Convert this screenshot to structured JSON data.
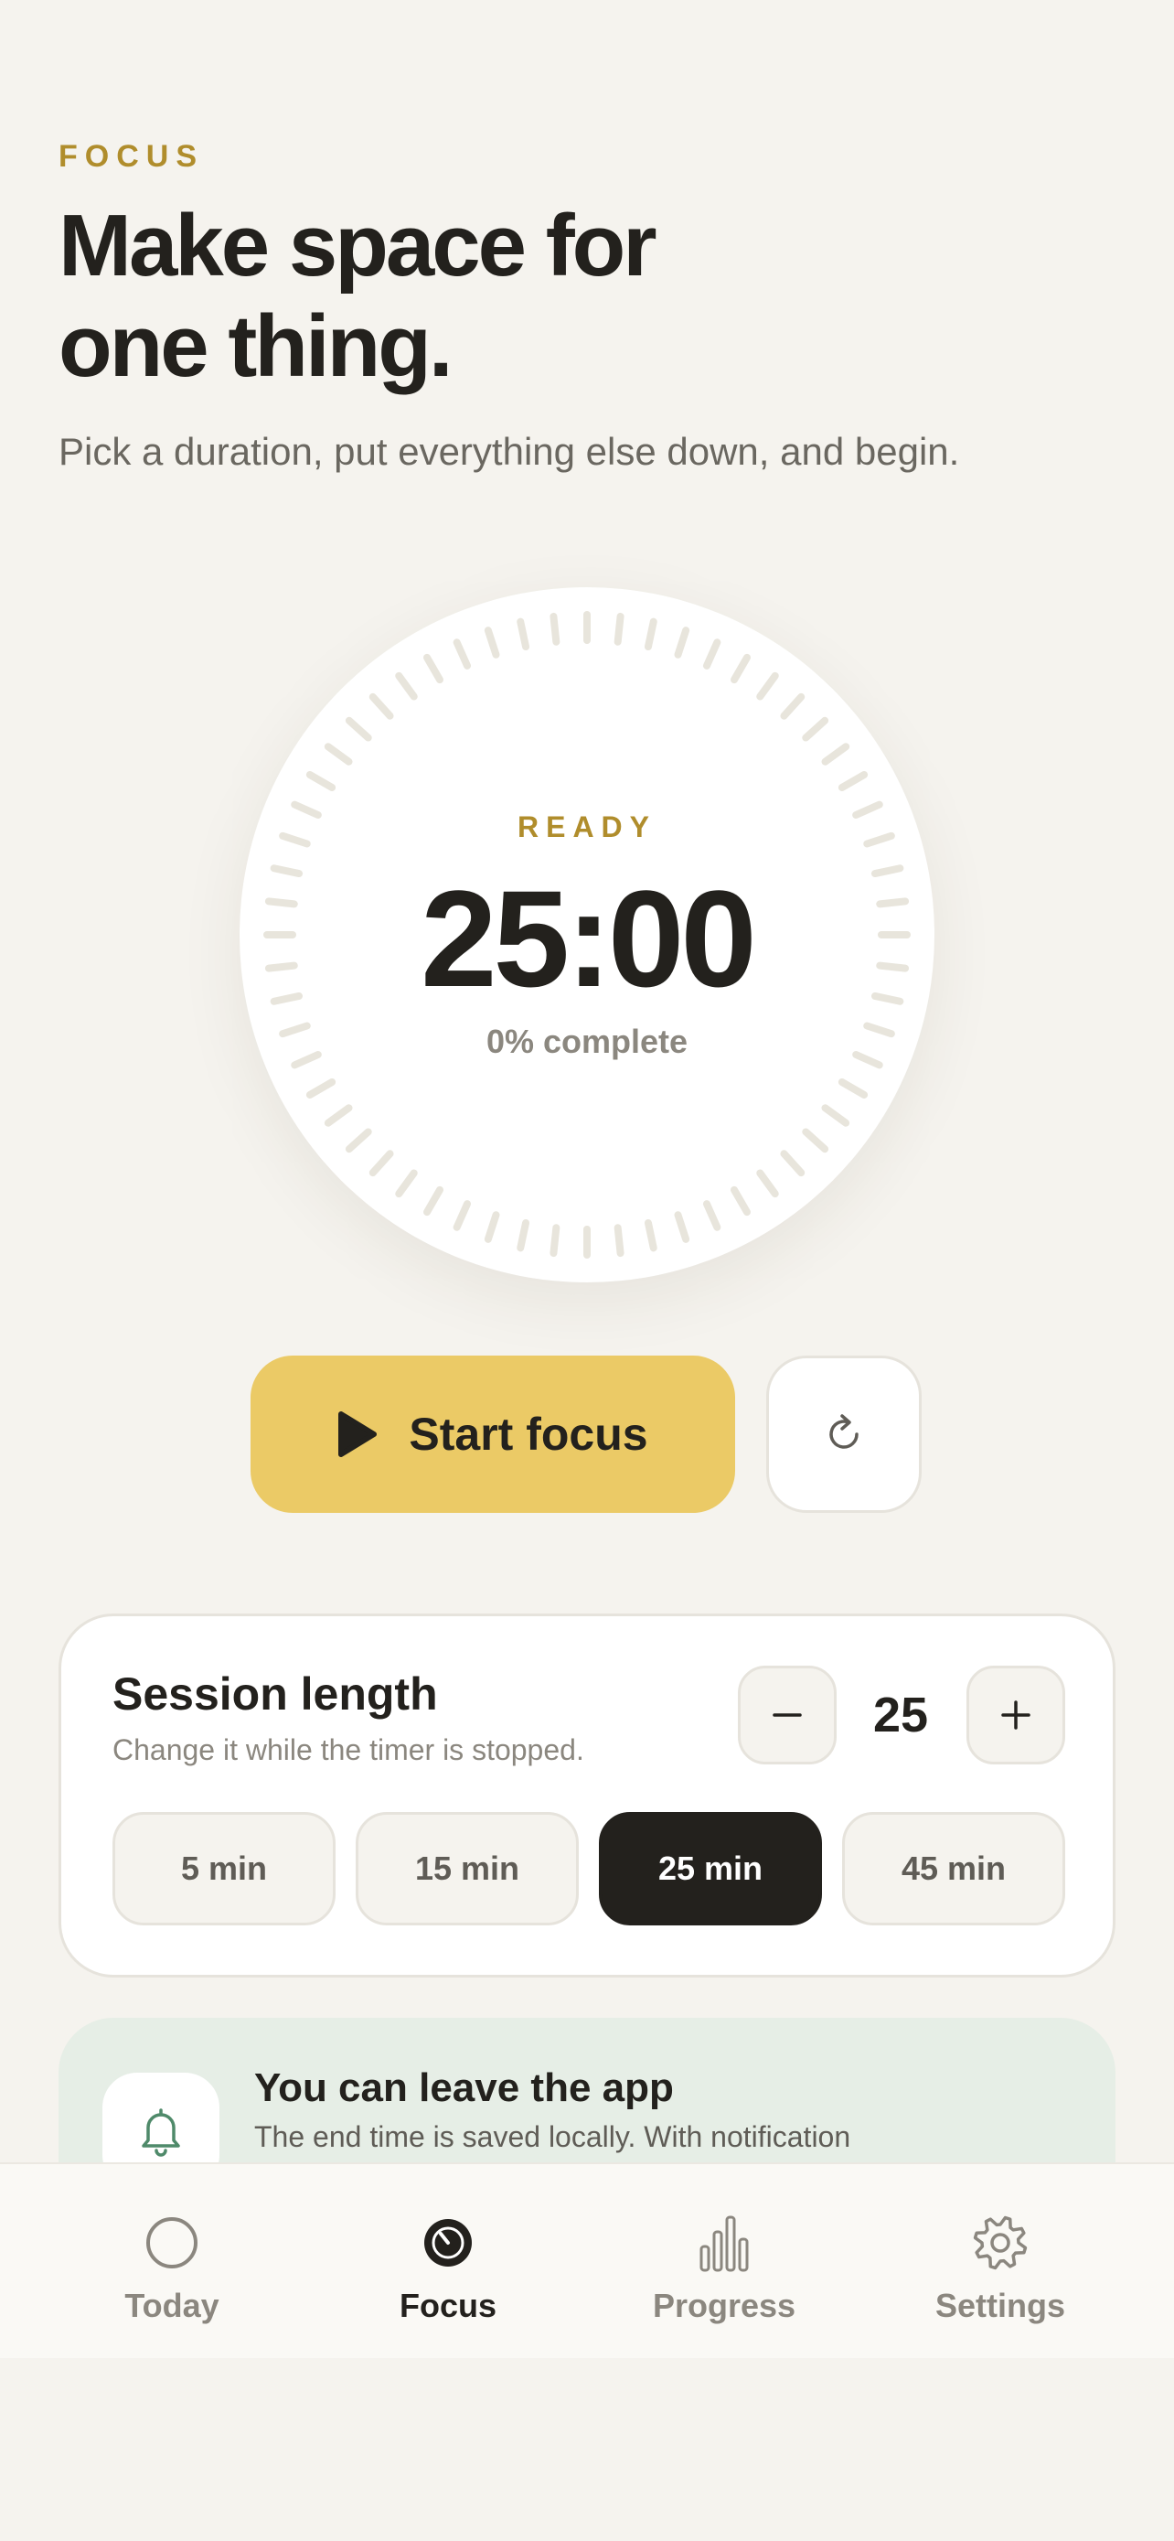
{
  "header": {
    "eyebrow": "FOCUS",
    "title_line1": "Make space for",
    "title_line2": "one thing.",
    "subtitle": "Pick a duration, put everything else down, and begin."
  },
  "timer": {
    "status": "READY",
    "time": "25:00",
    "progress_text": "0% complete",
    "progress": 0
  },
  "actions": {
    "start_label": "Start focus",
    "start_icon": "play-icon",
    "reset_icon": "refresh-icon"
  },
  "session": {
    "title": "Session length",
    "subtitle": "Change it while the timer is stopped.",
    "value": "25",
    "decrement_icon": "minus-icon",
    "increment_icon": "plus-icon",
    "presets": [
      {
        "label": "5 min",
        "selected": false
      },
      {
        "label": "15 min",
        "selected": false
      },
      {
        "label": "25 min",
        "selected": true
      },
      {
        "label": "45 min",
        "selected": false
      }
    ]
  },
  "notice": {
    "icon": "bell-icon",
    "title": "You can leave the app",
    "text": "The end time is saved locally. With notification"
  },
  "tabs": [
    {
      "label": "Today",
      "icon": "circle-icon",
      "active": false
    },
    {
      "label": "Focus",
      "icon": "timer-icon",
      "active": true
    },
    {
      "label": "Progress",
      "icon": "bar-chart-icon",
      "active": false
    },
    {
      "label": "Settings",
      "icon": "gear-icon",
      "active": false
    }
  ],
  "colors": {
    "background": "#f5f3ee",
    "accent_gold": "#b08d2c",
    "start_button": "#ebca66",
    "text_dark": "#23211d",
    "notice_bg": "#e6eee6",
    "tick": "#e8e5dc"
  }
}
